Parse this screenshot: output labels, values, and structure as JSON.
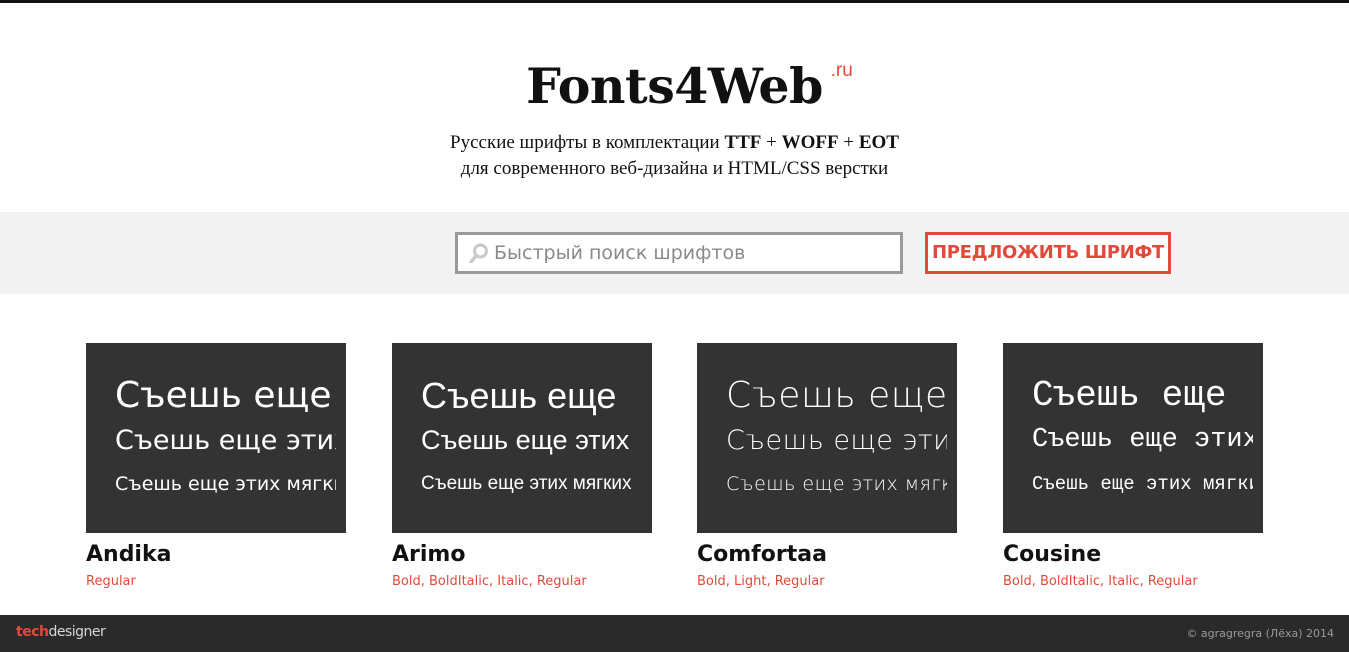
{
  "header": {
    "logo_text": "Fonts4Web",
    "logo_sup": ".ru",
    "tagline_line1_prefix": "Русские шрифты в комплектации",
    "format_ttf": "TTF",
    "format_woff": "WOFF",
    "format_eot": "EOT",
    "plus": "+",
    "tagline_line2": "для современного веб-дизайна и HTML/CSS верстки"
  },
  "search": {
    "placeholder": "Быстрый поиск шрифтов",
    "suggest_label": "ПРЕДЛОЖИТЬ ШРИФТ"
  },
  "colors": {
    "accent": "#e04a3a",
    "preview_bg": "#333333",
    "footer_bg": "#2a2a2a",
    "band_bg": "#f2f2f2"
  },
  "fonts": [
    {
      "name": "Andika",
      "preview": [
        "Съешь еще",
        "Съешь еще этих",
        "Съешь еще этих мягких"
      ],
      "styles": [
        "Regular"
      ]
    },
    {
      "name": "Arimo",
      "preview": [
        "Съешь еще",
        "Съешь еще этих",
        "Съешь еще этих мягких"
      ],
      "styles": [
        "Bold",
        "BoldItalic",
        "Italic",
        "Regular"
      ]
    },
    {
      "name": "Comfortaa",
      "preview": [
        "Съешь еще",
        "Съешь еще этих",
        "Съешь еще этих мягких"
      ],
      "styles": [
        "Bold",
        "Light",
        "Regular"
      ]
    },
    {
      "name": "Cousine",
      "preview": [
        "Съешь еще",
        "Съешь еще этих",
        "Съешь еще этих мягких"
      ],
      "styles": [
        "Bold",
        "BoldItalic",
        "Italic",
        "Regular"
      ]
    }
  ],
  "footer": {
    "logo_tech": "tech",
    "logo_designer": "designer",
    "copyright": "© agragregra (Лёха) 2014"
  }
}
